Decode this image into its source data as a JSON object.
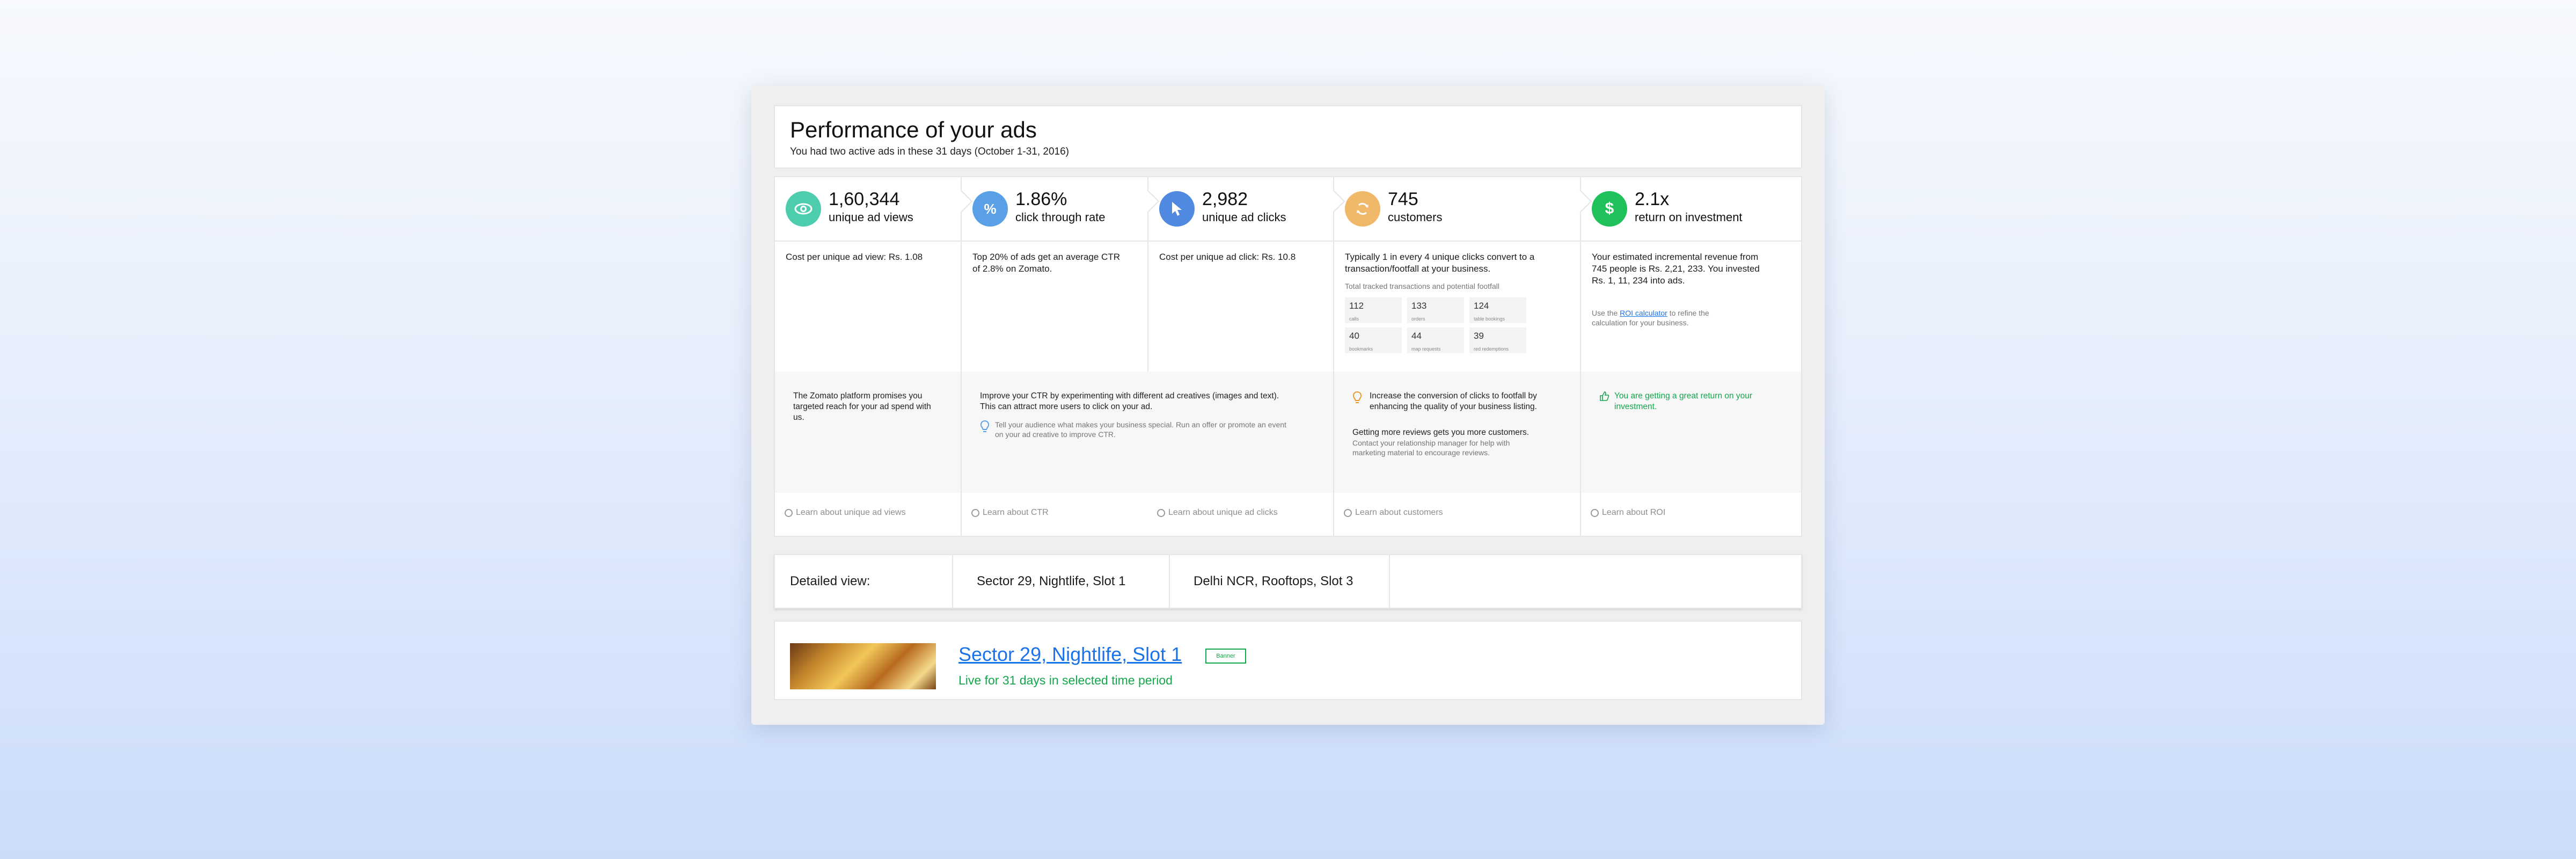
{
  "header": {
    "title": "Performance of your ads",
    "subtitle": "You had two active ads in these 31 days (October 1-31, 2016)"
  },
  "metrics": [
    {
      "icon": "eye-icon",
      "color": "#4ecdae",
      "value": "1,60,344",
      "label": "unique ad views",
      "body": "Cost per unique ad view: Rs. 1.08",
      "tip": "The Zomato platform promises you targeted reach for your ad spend with us.",
      "learn": "Learn about unique ad views"
    },
    {
      "icon": "percent-icon",
      "color": "#5aa0e6",
      "value": "1.86%",
      "label": "click through rate",
      "body": "Top 20% of ads get an average CTR of 2.8% on Zomato.",
      "tip": "Improve your CTR by experimenting with different ad creatives (images and text).  This can attract more users to click on your ad.",
      "tip_note": "Tell your audience what makes your business special.  Run an offer or promote an event on your ad creative to improve CTR.",
      "learn": "Learn about CTR"
    },
    {
      "icon": "cursor-icon",
      "color": "#4f8ae0",
      "value": "2,982",
      "label": "unique ad clicks",
      "body": "Cost per unique ad click: Rs. 10.8",
      "learn": "Learn about unique ad clicks"
    },
    {
      "icon": "refresh-icon",
      "color": "#f0b96a",
      "value": "745",
      "label": "customers",
      "body": "Typically 1 in every 4 unique clicks convert to a transaction/footfall at your business.",
      "sub": "Total tracked transactions and potential footfall",
      "stats": [
        {
          "num": "112",
          "label": "calls"
        },
        {
          "num": "133",
          "label": "orders"
        },
        {
          "num": "124",
          "label": "table bookings"
        },
        {
          "num": "40",
          "label": "bookmarks"
        },
        {
          "num": "44",
          "label": "map requests"
        },
        {
          "num": "39",
          "label": "red redemptions"
        }
      ],
      "tip": "Increase the conversion of clicks to footfall by enhancing the quality of your business listing.",
      "tip2_title": "Getting more reviews gets you more customers.",
      "tip2_body": "Contact your relationship manager for help with marketing material to encourage reviews.",
      "learn": "Learn about customers"
    },
    {
      "icon": "dollar-icon",
      "color": "#1fc15a",
      "value": "2.1x",
      "label": "return on investment",
      "body": "Your estimated incremental revenue from 745 people is Rs. 2,21, 233.  You invested Rs. 1, 11, 234 into ads.",
      "note_pre": "Use the ",
      "note_link": "ROI calculator",
      "note_post": " to refine the calculation for your business.",
      "tip": "You are getting a great return on your investment.",
      "learn": "Learn about ROI"
    }
  ],
  "detail": {
    "label": "Detailed view:",
    "tabs": [
      "Sector 29, Nightlife, Slot 1",
      "Delhi NCR, Rooftops, Slot 3"
    ]
  },
  "ad": {
    "title": "Sector 29, Nightlife, Slot 1",
    "badge": "Banner",
    "status": "Live for 31 days in selected time period"
  }
}
